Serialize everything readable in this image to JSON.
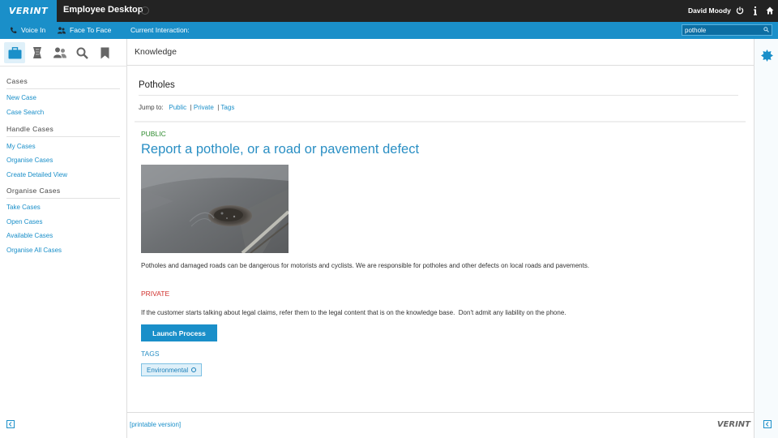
{
  "header": {
    "logo_text": "VERINT",
    "app_title": "Employee Desktop",
    "user_name": "David Moody",
    "icons": [
      "power-icon",
      "info-icon",
      "home-icon"
    ]
  },
  "interaction_bar": {
    "voice_in": "Voice In",
    "face_to_face": "Face To Face",
    "current_interaction_label": "Current Interaction:",
    "search_value": "pothole",
    "search_icon": "search-icon"
  },
  "sidebar": {
    "tabs": [
      "briefcase-icon",
      "scroll-icon",
      "people-icon",
      "search-icon",
      "bookmark-icon"
    ],
    "sections": [
      {
        "title": "Cases",
        "links": [
          "New Case",
          "Case Search"
        ]
      },
      {
        "title": "Handle Cases",
        "links": [
          "My Cases",
          "Organise Cases",
          "Create Detailed View"
        ]
      },
      {
        "title": "Organise Cases",
        "links": [
          "Take Cases",
          "Open Cases",
          "Available Cases",
          "Organise All Cases"
        ]
      }
    ]
  },
  "main": {
    "header_title": "Knowledge",
    "page_title": "Potholes",
    "jump_label": "Jump to:",
    "jump_links": [
      "Public",
      "Private",
      "Tags"
    ],
    "public_label": "PUBLIC",
    "article_title": "Report a pothole, or a road or pavement defect",
    "description": "Potholes and damaged roads can be dangerous for motorists and cyclists. We are responsible for potholes and other defects on local roads and pavements.",
    "private_label": "PRIVATE",
    "private_text": "If the customer starts talking about legal claims, refer them to the legal content that is on the knowledge base.  Don't admit any liability on the phone.",
    "launch_button": "Launch Process",
    "tags_label": "TAGS",
    "tags": [
      "Environmental"
    ]
  },
  "footer": {
    "printable_link": "[printable version]",
    "logo_text": "VERINT"
  },
  "colors": {
    "accent": "#1a8fc9",
    "topbar": "#232323",
    "public_green": "#2d8a2d",
    "private_red": "#d0312d"
  }
}
